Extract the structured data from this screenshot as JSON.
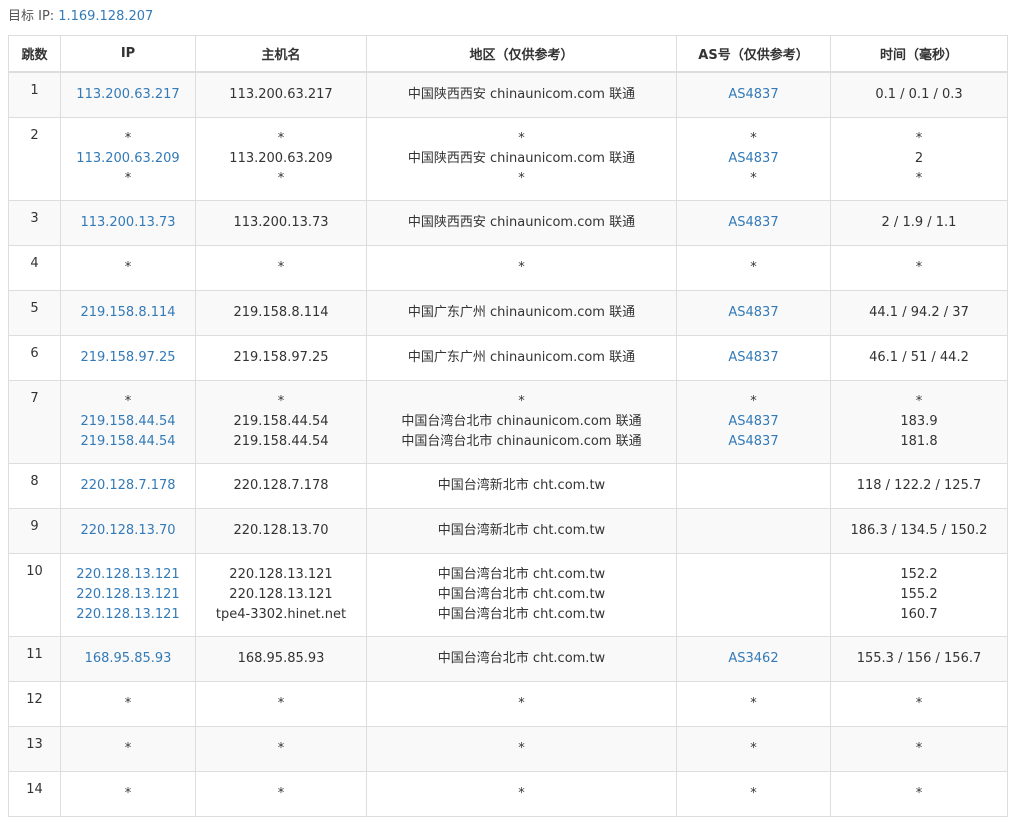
{
  "target": {
    "label": "目标 IP:",
    "ip": "1.169.128.207"
  },
  "headers": [
    "跳数",
    "IP",
    "主机名",
    "地区（仅供参考）",
    "AS号（仅供参考）",
    "时间（毫秒）"
  ],
  "rows": [
    {
      "hop": "1",
      "ip": [
        "113.200.63.217"
      ],
      "host": [
        "113.200.63.217"
      ],
      "region": [
        "中国陕西西安 chinaunicom.com 联通"
      ],
      "as": [
        "AS4837"
      ],
      "time": [
        "0.1 / 0.1 / 0.3"
      ]
    },
    {
      "hop": "2",
      "ip": [
        "*",
        "113.200.63.209",
        "*"
      ],
      "host": [
        "*",
        "113.200.63.209",
        "*"
      ],
      "region": [
        "*",
        "中国陕西西安 chinaunicom.com 联通",
        "*"
      ],
      "as": [
        "*",
        "AS4837",
        "*"
      ],
      "time": [
        "*",
        "2",
        "*"
      ]
    },
    {
      "hop": "3",
      "ip": [
        "113.200.13.73"
      ],
      "host": [
        "113.200.13.73"
      ],
      "region": [
        "中国陕西西安 chinaunicom.com 联通"
      ],
      "as": [
        "AS4837"
      ],
      "time": [
        "2 / 1.9 / 1.1"
      ]
    },
    {
      "hop": "4",
      "ip": [
        "*"
      ],
      "host": [
        "*"
      ],
      "region": [
        "*"
      ],
      "as": [
        "*"
      ],
      "time": [
        "*"
      ]
    },
    {
      "hop": "5",
      "ip": [
        "219.158.8.114"
      ],
      "host": [
        "219.158.8.114"
      ],
      "region": [
        "中国广东广州 chinaunicom.com 联通"
      ],
      "as": [
        "AS4837"
      ],
      "time": [
        "44.1 / 94.2 / 37"
      ]
    },
    {
      "hop": "6",
      "ip": [
        "219.158.97.25"
      ],
      "host": [
        "219.158.97.25"
      ],
      "region": [
        "中国广东广州 chinaunicom.com 联通"
      ],
      "as": [
        "AS4837"
      ],
      "time": [
        "46.1 / 51 / 44.2"
      ]
    },
    {
      "hop": "7",
      "ip": [
        "*",
        "219.158.44.54",
        "219.158.44.54"
      ],
      "host": [
        "*",
        "219.158.44.54",
        "219.158.44.54"
      ],
      "region": [
        "*",
        "中国台湾台北市 chinaunicom.com 联通",
        "中国台湾台北市 chinaunicom.com 联通"
      ],
      "as": [
        "*",
        "AS4837",
        "AS4837"
      ],
      "time": [
        "*",
        "183.9",
        "181.8"
      ]
    },
    {
      "hop": "8",
      "ip": [
        "220.128.7.178"
      ],
      "host": [
        "220.128.7.178"
      ],
      "region": [
        "中国台湾新北市 cht.com.tw"
      ],
      "as": [
        ""
      ],
      "time": [
        "118 / 122.2 / 125.7"
      ]
    },
    {
      "hop": "9",
      "ip": [
        "220.128.13.70"
      ],
      "host": [
        "220.128.13.70"
      ],
      "region": [
        "中国台湾新北市 cht.com.tw"
      ],
      "as": [
        ""
      ],
      "time": [
        "186.3 / 134.5 / 150.2"
      ]
    },
    {
      "hop": "10",
      "ip": [
        "220.128.13.121",
        "220.128.13.121",
        "220.128.13.121"
      ],
      "host": [
        "220.128.13.121",
        "220.128.13.121",
        "tpe4-3302.hinet.net"
      ],
      "region": [
        "中国台湾台北市 cht.com.tw",
        "中国台湾台北市 cht.com.tw",
        "中国台湾台北市 cht.com.tw"
      ],
      "as": [
        ""
      ],
      "time": [
        "152.2",
        "155.2",
        "160.7"
      ]
    },
    {
      "hop": "11",
      "ip": [
        "168.95.85.93"
      ],
      "host": [
        "168.95.85.93"
      ],
      "region": [
        "中国台湾台北市 cht.com.tw"
      ],
      "as": [
        "AS3462"
      ],
      "time": [
        "155.3 / 156 / 156.7"
      ]
    },
    {
      "hop": "12",
      "ip": [
        "*"
      ],
      "host": [
        "*"
      ],
      "region": [
        "*"
      ],
      "as": [
        "*"
      ],
      "time": [
        "*"
      ]
    },
    {
      "hop": "13",
      "ip": [
        "*"
      ],
      "host": [
        "*"
      ],
      "region": [
        "*"
      ],
      "as": [
        "*"
      ],
      "time": [
        "*"
      ]
    },
    {
      "hop": "14",
      "ip": [
        "*"
      ],
      "host": [
        "*"
      ],
      "region": [
        "*"
      ],
      "as": [
        "*"
      ],
      "time": [
        "*"
      ]
    }
  ]
}
